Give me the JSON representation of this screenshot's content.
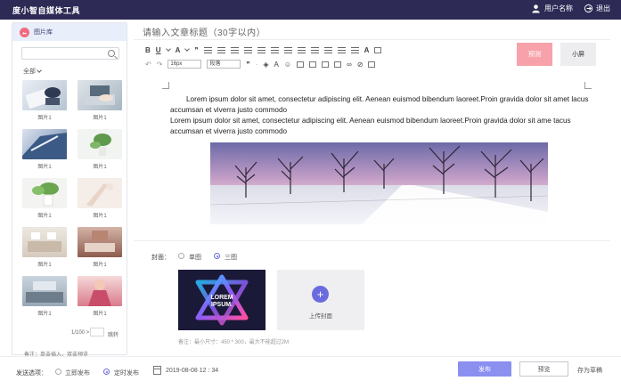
{
  "app": {
    "title": "度小智自媒体工具",
    "user": "用户名称",
    "logout": "退出"
  },
  "library": {
    "header": "图片库",
    "search_placeholder": "",
    "filter": "全部",
    "items": [
      "图片1",
      "图片1",
      "图片1",
      "图片1",
      "图片1",
      "图片1",
      "图片1",
      "图片1",
      "图片1",
      "图片1"
    ],
    "pager_text": "1/100 >",
    "pager_go": "跳转",
    "note": "备注：单击插入，双击预览"
  },
  "editor": {
    "title_placeholder": "请输入文章标题（30字以内）",
    "toolbar": {
      "bold": "B",
      "underline": "U",
      "font": "A",
      "quote": "❞",
      "font_size": "16px",
      "paragraph": "段落",
      "quote2": "❞"
    },
    "preview_btn": "预测",
    "small_btn": "小屏",
    "paragraphs": [
      "Lorem ipsum dolor sit amet, consectetur adipiscing elit. Aenean euismod bibendum laoreet.Proin gravida dolor sit amet lacus accumsan et viverra justo commodo",
      "Lorem ipsum dolor sit amet, consectetur adipiscing elit. Aenean euismod bibendum laoreet.Proin gravida dolor sit ame tacus accumsan et viverra justo commodo"
    ]
  },
  "cover": {
    "label": "封面：",
    "options": [
      "单图",
      "三图"
    ],
    "selected": "三图",
    "image_text": [
      "LOREM",
      "IPSUM."
    ],
    "upload_label": "上传封面",
    "note": "备注：最小尺寸：450 * 300，最大不能超过2M"
  },
  "bottom": {
    "send_label": "发送选项：",
    "options": [
      "立即发布",
      "定时发布"
    ],
    "selected": "定时发布",
    "datetime": "2019-08-08  12 : 34",
    "publish": "发布",
    "preview": "预览",
    "save_draft": "存为草稿"
  },
  "colors": {
    "topbar": "#2d2a55",
    "accent": "#6b6be0",
    "preview_btn": "#f7a2aa",
    "publish_btn": "#8b8ff0"
  }
}
